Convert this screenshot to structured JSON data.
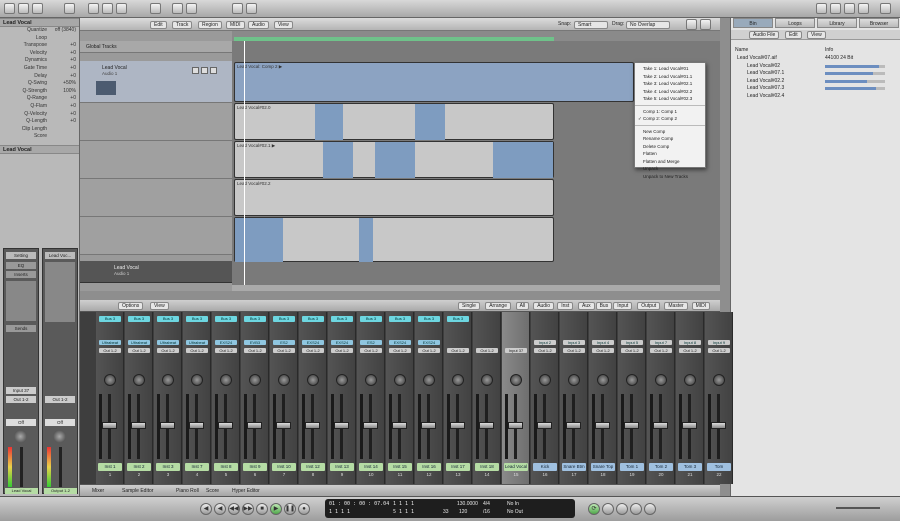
{
  "inspector": {
    "track_title": "Lead Vocal",
    "params": [
      {
        "label": "Quantize",
        "value": "off (3840)"
      },
      {
        "label": "Loop",
        "value": ""
      },
      {
        "label": "Transpose",
        "value": "+0"
      },
      {
        "label": "Velocity",
        "value": "+0"
      },
      {
        "label": "Dynamics",
        "value": "+0"
      },
      {
        "label": "Gate Time",
        "value": "+0"
      },
      {
        "label": "Delay",
        "value": "+0"
      },
      {
        "label": "Q-Swing",
        "value": "+50%"
      },
      {
        "label": "Q-Strength",
        "value": "100%"
      },
      {
        "label": "Q-Range",
        "value": "+0"
      },
      {
        "label": "Q-Flam",
        "value": "+0"
      },
      {
        "label": "Q-Velocity",
        "value": "+0"
      },
      {
        "label": "Q-Length",
        "value": "+0"
      },
      {
        "label": "Clip Length",
        "value": ""
      },
      {
        "label": "Score",
        "value": ""
      }
    ],
    "section2": "Lead Vocal",
    "left_strip": {
      "setting": "Setting",
      "eq": "EQ",
      "inserts": "Inserts",
      "send": "Sends",
      "io": "Input 37",
      "out": "Out 1-2",
      "read": "Off",
      "name": "Lead Vocal"
    },
    "right_strip": {
      "setting": "Lead Voc...",
      "io": "Out 1-2",
      "read": "Off",
      "name": "Output 1-2"
    }
  },
  "toolbar": {
    "menus": [
      "Edit",
      "Track",
      "Region",
      "MIDI",
      "Audio",
      "View"
    ],
    "snap_label": "Snap:",
    "snap_value": "Smart",
    "drag_label": "Drag:",
    "drag_value": "No Overlap"
  },
  "tracks": {
    "global": "Global Tracks",
    "items": [
      {
        "name": "Lead Vocal",
        "sub": "Audio 1"
      },
      {
        "name": "Lead Vocal",
        "sub": "Audio 1"
      }
    ],
    "regions": [
      {
        "title": "Lead Vocal: Comp 2  ▶"
      },
      {
        "title": "Lead Vocal#02.0"
      },
      {
        "title": "Lead Vocal#02.1  ▶"
      },
      {
        "title": "Lead Vocal#02.2"
      },
      {
        "title": "Lead Vocal#02.3"
      }
    ]
  },
  "comp_menu": {
    "items": [
      "Take 1: Lead Vocal#01",
      "Take 2: Lead Vocal#01.1",
      "Take 3: Lead Vocal#02.1",
      "Take 4: Lead Vocal#02.2",
      "Take 5: Lead Vocal#02.3",
      "Comp 1: Comp 1",
      "✓ Comp 2: Comp 2",
      "New Comp",
      "Rename Comp",
      "Delete Comp",
      "Flatten",
      "Flatten and Merge",
      "Unpack",
      "Unpack to New Tracks"
    ]
  },
  "browser": {
    "tabs": [
      "Bin",
      "Loops",
      "Library",
      "Browser"
    ],
    "controls": [
      "Audio File",
      "Edit",
      "View"
    ],
    "col_name": "Name",
    "col_info": "Info",
    "files": [
      {
        "name": "Lead Vocal#07.aif",
        "info": "44100  24 Bit",
        "level": 0
      },
      {
        "name": "Lead Vocal#02",
        "info": "",
        "level": 0.9
      },
      {
        "name": "Lead Vocal#07.1",
        "info": "",
        "level": 0.8
      },
      {
        "name": "Lead Vocal#02.2",
        "info": "",
        "level": 0.7
      },
      {
        "name": "Lead Vocal#07.3",
        "info": "",
        "level": 0.85
      },
      {
        "name": "Lead Vocal#02.4",
        "info": "",
        "level": 0
      }
    ]
  },
  "mixer": {
    "options": "Options",
    "view": "View",
    "filters": [
      "Single",
      "Arrange",
      "All",
      "Audio",
      "Inst",
      "Aux",
      "Bus",
      "Input",
      "Output",
      "Master",
      "MIDI"
    ],
    "strips": [
      {
        "bus": "Bus 3",
        "insert": "Ultrabeat",
        "out": "Out 1-2",
        "name": "Inst 1",
        "num": "1"
      },
      {
        "bus": "Bus 3",
        "insert": "Ultrabeat",
        "out": "Out 1-2",
        "name": "Inst 2",
        "num": "2"
      },
      {
        "bus": "Bus 3",
        "insert": "Ultrabeat",
        "out": "Out 1-2",
        "name": "Inst 3",
        "num": "3"
      },
      {
        "bus": "Bus 3",
        "insert": "Ultrabeat",
        "out": "Out 1-2",
        "name": "Inst 7",
        "num": "4"
      },
      {
        "bus": "Bus 3",
        "insert": "EXS24",
        "out": "Out 1-2",
        "name": "Inst 8",
        "num": "5"
      },
      {
        "bus": "Bus 3",
        "insert": "EVB3",
        "out": "Out 1-2",
        "name": "Inst 9",
        "num": "6"
      },
      {
        "bus": "Bus 3",
        "insert": "ES2",
        "out": "Out 1-2",
        "name": "Inst 10",
        "num": "7"
      },
      {
        "bus": "Bus 3",
        "insert": "EXS24",
        "out": "Out 1-2",
        "name": "Inst 12",
        "num": "8"
      },
      {
        "bus": "Bus 3",
        "insert": "EXS24",
        "out": "Out 1-2",
        "name": "Inst 13",
        "num": "9"
      },
      {
        "bus": "Bus 3",
        "insert": "ES2",
        "out": "Out 1-2",
        "name": "Inst 14",
        "num": "10"
      },
      {
        "bus": "Bus 3",
        "insert": "EXS24",
        "out": "Out 1-2",
        "name": "Inst 15",
        "num": "11"
      },
      {
        "bus": "Bus 3",
        "insert": "EXS24",
        "out": "Out 1-2",
        "name": "Inst 16",
        "num": "12"
      },
      {
        "bus": "Bus 3",
        "insert": "",
        "out": "Out 1-2",
        "name": "Inst 17",
        "num": "13"
      },
      {
        "bus": "",
        "insert": "",
        "out": "Out 1-2",
        "name": "Inst 18",
        "num": "14"
      },
      {
        "bus": "",
        "insert": "",
        "out": "Input 37",
        "name": "Lead Vocal",
        "num": "15"
      },
      {
        "bus": "",
        "insert": "Input 2",
        "out": "Out 1-2",
        "name": "Kick",
        "num": "16"
      },
      {
        "bus": "",
        "insert": "Input 3",
        "out": "Out 1-2",
        "name": "Snare Btm",
        "num": "17"
      },
      {
        "bus": "",
        "insert": "Input 4",
        "out": "Out 1-2",
        "name": "Snare Top",
        "num": "18"
      },
      {
        "bus": "",
        "insert": "Input 5",
        "out": "Out 1-2",
        "name": "Tom 1",
        "num": "19"
      },
      {
        "bus": "",
        "insert": "Input 7",
        "out": "Out 1-2",
        "name": "Tom 2",
        "num": "20"
      },
      {
        "bus": "",
        "insert": "Input 8",
        "out": "Out 1-2",
        "name": "Tom 3",
        "num": "21"
      },
      {
        "bus": "",
        "insert": "Input 9",
        "out": "Out 1-2",
        "name": "Tom",
        "num": "22"
      }
    ]
  },
  "bottom_tabs": [
    "Mixer",
    "Sample Editor",
    "Piano Roll",
    "Score",
    "Hyper Editor"
  ],
  "transport": {
    "position": "01 : 00 : 00 : 07.04",
    "bars": "1  1  1  1",
    "tempo": "130.0000",
    "sig": "4/4",
    "division": "/16",
    "in": "No In",
    "out": "No Out",
    "locators": "5  1  1  1",
    "end": "33",
    "key": "120"
  }
}
